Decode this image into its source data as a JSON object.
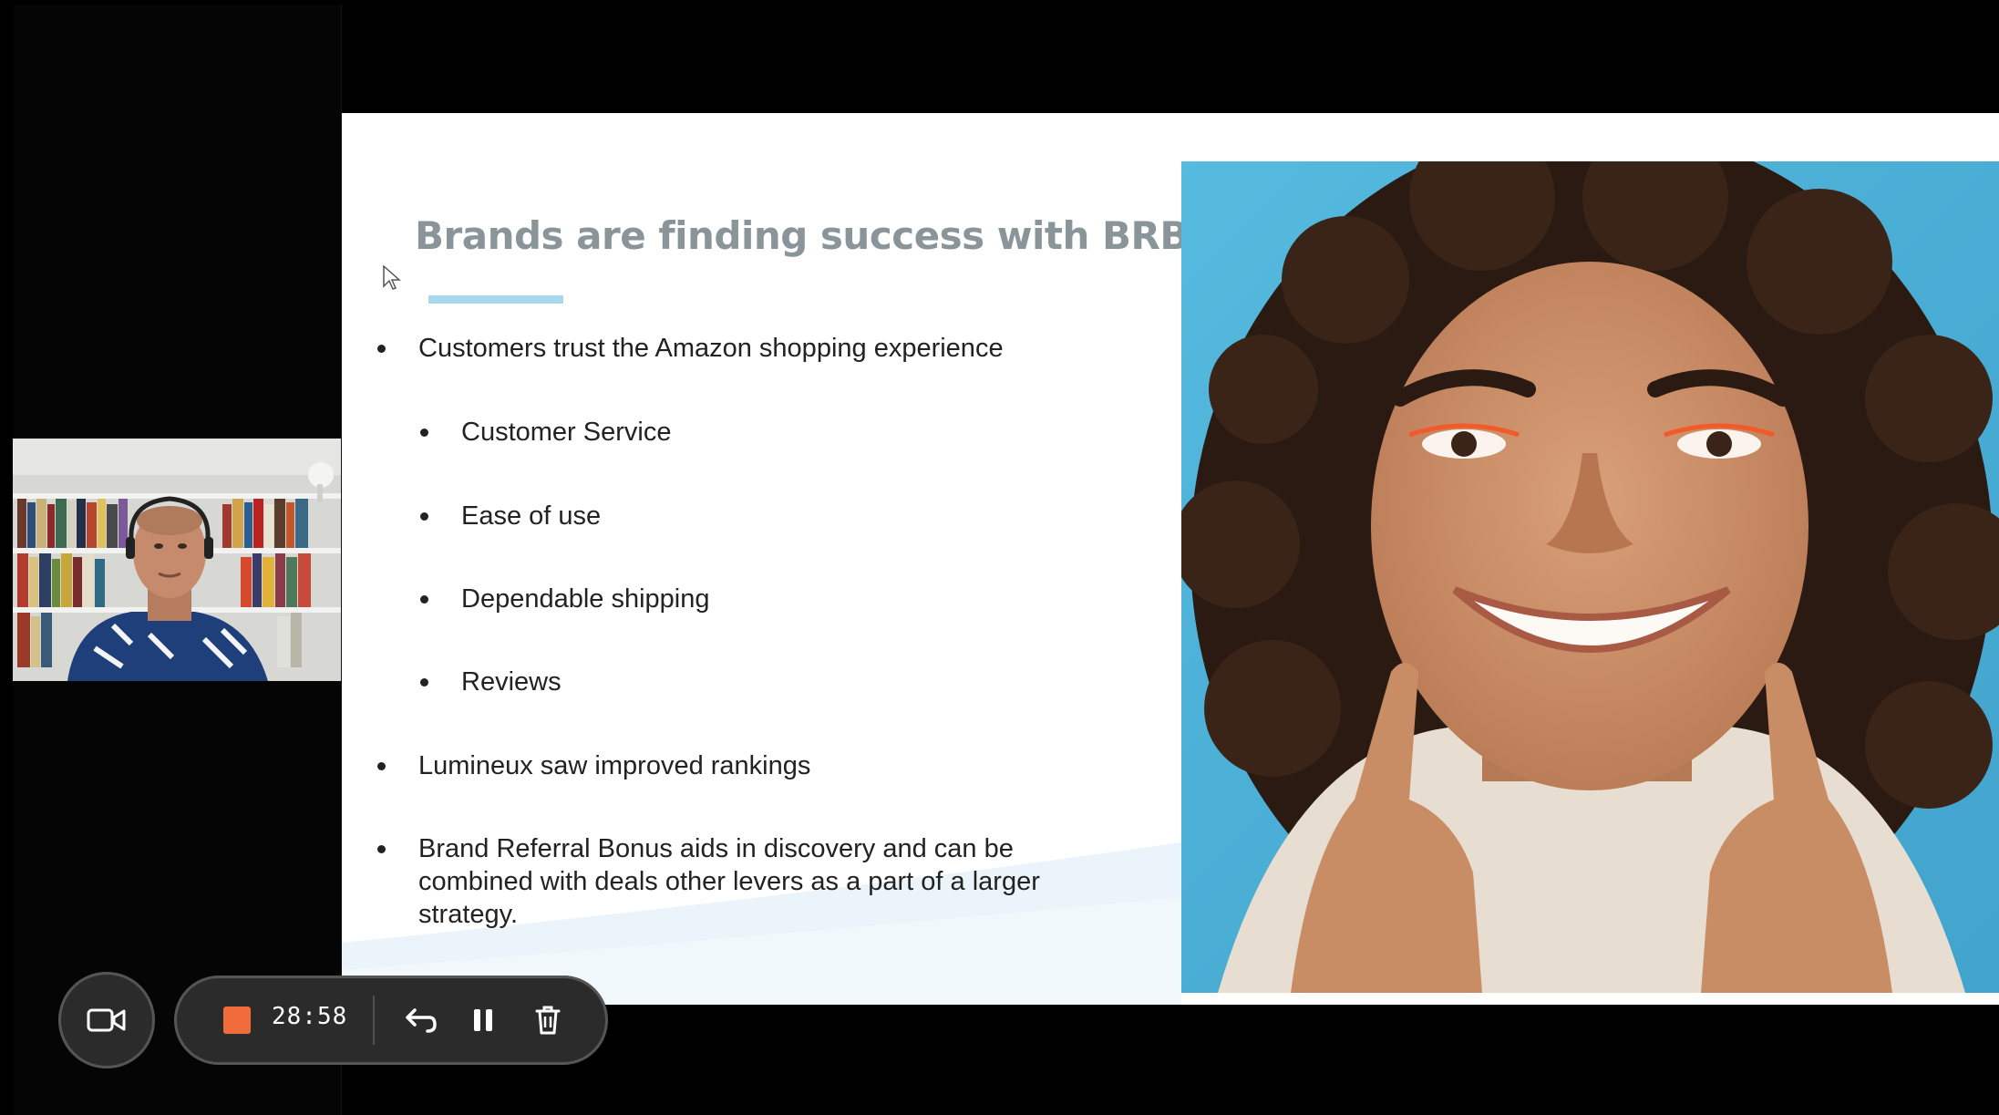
{
  "slide": {
    "title": "Brands are finding success with BRB",
    "bullets": [
      {
        "text": "Customers trust the Amazon shopping experience",
        "level": 1
      },
      {
        "text": "Customer Service",
        "level": 2
      },
      {
        "text": "Ease of use",
        "level": 2
      },
      {
        "text": "Dependable shipping",
        "level": 2
      },
      {
        "text": "Reviews",
        "level": 2
      },
      {
        "text": "Lumineux saw improved rankings",
        "level": 1
      },
      {
        "text": "Brand Referral Bonus aids in discovery and can be combined with deals other levers as a part of a larger strategy.",
        "level": 1
      }
    ]
  },
  "recorder": {
    "timer": "28:58",
    "stop_color": "#f26b3a",
    "icons": {
      "camera": "video-camera-icon",
      "stop": "stop-icon",
      "undo": "undo-icon",
      "pause": "pause-icon",
      "delete": "trash-icon"
    }
  },
  "colors": {
    "title": "#8a959a",
    "accent": "#a8d8ee",
    "photo_background": "#4fb3d9"
  }
}
